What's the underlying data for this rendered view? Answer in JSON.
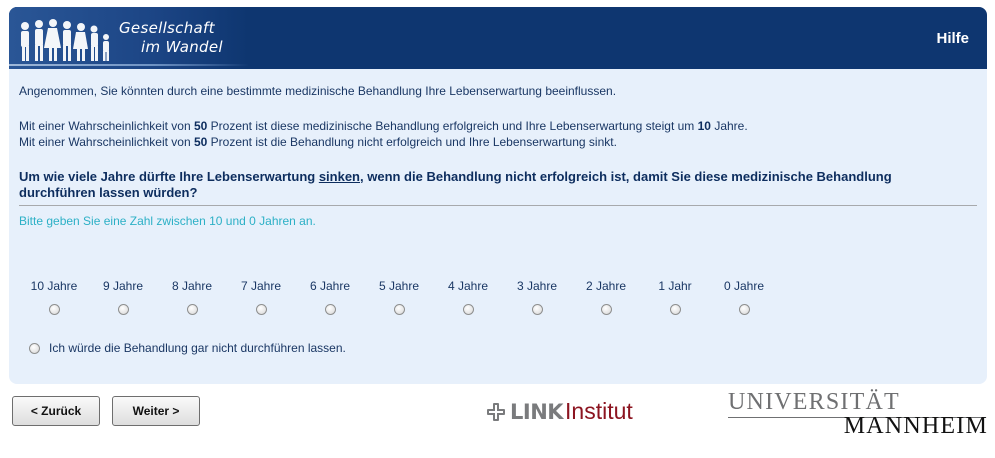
{
  "header": {
    "title_line1": "Gesellschaft",
    "title_line2": "im Wandel",
    "help_label": "Hilfe",
    "colors": {
      "bar": "#0e3670",
      "text": "#ffffff"
    }
  },
  "survey": {
    "intro": "Angenommen, Sie könnten durch eine bestimmte medizinische Behandlung Ihre Lebenserwartung beeinflussen.",
    "line1_a": "Mit einer Wahrscheinlichkeit von ",
    "line1_num": "50",
    "line1_b": " Prozent ist diese medizinische Behandlung erfolgreich und Ihre Lebenserwartung steigt um ",
    "line1_years": "10",
    "line1_c": " Jahre.",
    "line2_a": "Mit einer Wahrscheinlichkeit von ",
    "line2_num": "50",
    "line2_b": " Prozent ist die Behandlung nicht erfolgreich und Ihre Lebenserwartung sinkt.",
    "question_a": "Um wie viele Jahre dürfte Ihre Lebenserwartung ",
    "question_emph": "sinken",
    "question_b": ", wenn die Behandlung nicht erfolgreich ist, damit Sie diese medizinische Behandlung durchführen lassen würden?",
    "hint": "Bitte geben Sie eine Zahl zwischen 10 und 0 Jahren an.",
    "options": [
      "10 Jahre",
      "9 Jahre",
      "8 Jahre",
      "7 Jahre",
      "6 Jahre",
      "5 Jahre",
      "4 Jahre",
      "3 Jahre",
      "2 Jahre",
      "1 Jahr",
      "0 Jahre"
    ],
    "refuse_option": "Ich würde die Behandlung gar nicht durchführen lassen.",
    "colors": {
      "panel": "#e7f0fb",
      "hint": "#2cb0c6",
      "text": "#1a3764"
    }
  },
  "nav": {
    "back_label": "< Zurück",
    "next_label": "Weiter >"
  },
  "logos": {
    "link_text": "LINK",
    "institut_text": "Institut",
    "university_line1": "UNIVERSITÄT",
    "university_line2": "MANNHEIM",
    "colors": {
      "institut": "#8c1420",
      "link": "#7a7b7d"
    }
  }
}
